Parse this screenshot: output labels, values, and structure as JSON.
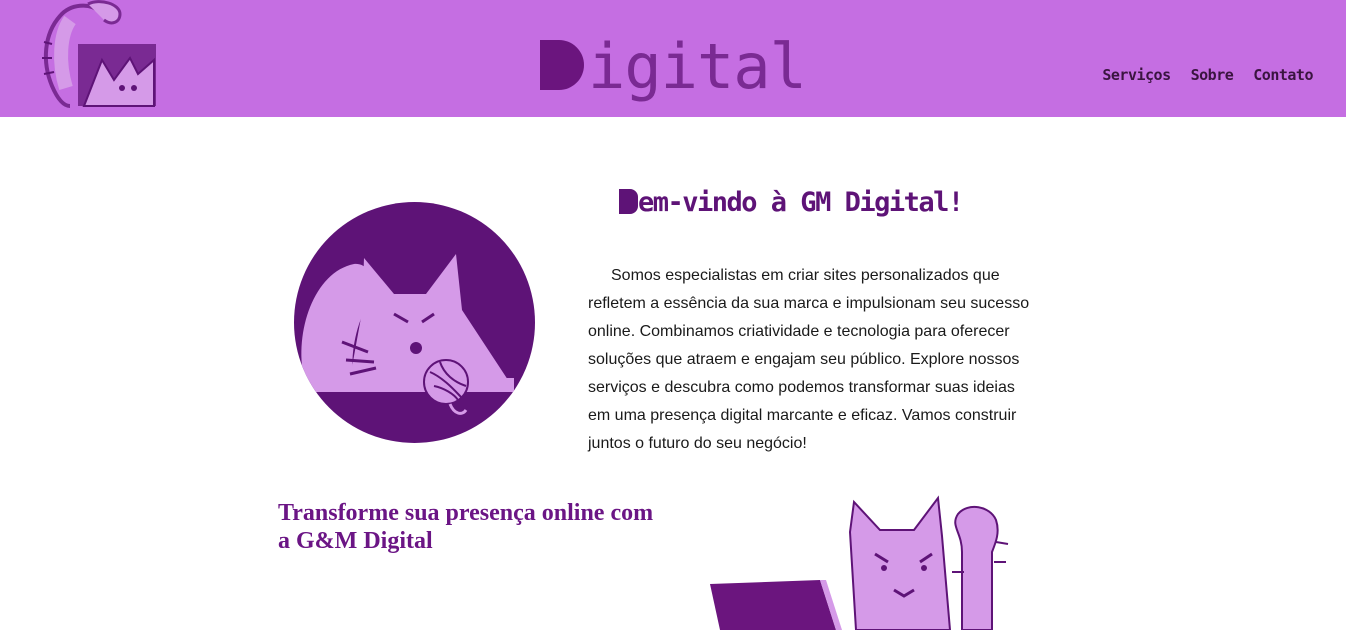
{
  "header": {
    "logo_icon": "gm-cat-logo-icon",
    "brand_letter": "D",
    "brand_rest": "igital",
    "nav": [
      {
        "label": "Serviços"
      },
      {
        "label": "Sobre"
      },
      {
        "label": "Contato"
      }
    ]
  },
  "hero": {
    "title_letter": "B",
    "title_rest": "em-vindo à GM Digital!",
    "intro": "Somos especialistas em criar sites personalizados que refletem a essência da sua marca e impulsionam seu sucesso online. Combinamos criatividade e tecnologia para oferecer soluções que atraem e engajam seu público. Explore nossos serviços e descubra como podemos transformar suas ideias em uma presença digital marcante e eficaz. Vamos construir juntos o futuro do seu negócio!",
    "illustration_icon": "cat-with-yarn-icon"
  },
  "secondary": {
    "tagline": "Transforme sua presença online com a G&M Digital",
    "illustration_icon": "cat-with-laptop-icon"
  },
  "colors": {
    "header_bg": "#c56ee2",
    "brand_purple": "#6b157e",
    "light_purple": "#d59ae8",
    "text_dark": "#1a1a1a"
  }
}
